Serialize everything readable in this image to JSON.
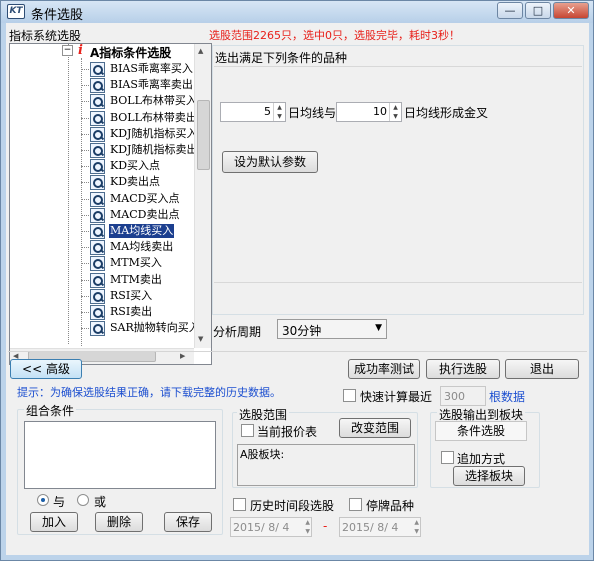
{
  "window": {
    "title": "条件选股",
    "icon_text": "KT",
    "controls": {
      "minimize": "—",
      "maximize": "□",
      "close": "✕"
    }
  },
  "left_panel": {
    "heading": "指标系统选股",
    "tree_root": {
      "expander": "−",
      "marker": "i",
      "label": "A指标条件选股"
    },
    "tree_items": [
      {
        "label": "BIAS乖离率买入",
        "selected": false
      },
      {
        "label": "BIAS乖离率卖出",
        "selected": false
      },
      {
        "label": "BOLL布林带买入",
        "selected": false
      },
      {
        "label": "BOLL布林带卖出",
        "selected": false
      },
      {
        "label": "KDJ随机指标买入",
        "selected": false
      },
      {
        "label": "KDJ随机指标卖出",
        "selected": false
      },
      {
        "label": "KD买入点",
        "selected": false
      },
      {
        "label": "KD卖出点",
        "selected": false
      },
      {
        "label": "MACD买入点",
        "selected": false
      },
      {
        "label": "MACD卖出点",
        "selected": false
      },
      {
        "label": "MA均线买入",
        "selected": true
      },
      {
        "label": "MA均线卖出",
        "selected": false
      },
      {
        "label": "MTM买入",
        "selected": false
      },
      {
        "label": "MTM卖出",
        "selected": false
      },
      {
        "label": "RSI买入",
        "selected": false
      },
      {
        "label": "RSI卖出",
        "selected": false
      },
      {
        "label": "SAR抛物转向买入",
        "selected": false
      }
    ]
  },
  "status_message": "选股范围2265只，选中0只，选股完毕，耗时3秒！",
  "condition": {
    "heading": "选出满足下列条件的品种",
    "param1": "5",
    "text1": "日均线与",
    "param2": "10",
    "text2": "日均线形成金叉",
    "default_button": "设为默认参数"
  },
  "period": {
    "label": "分析周期",
    "value": "30分钟"
  },
  "buttons": {
    "advanced": "<< 高级",
    "success_test": "成功率测试",
    "execute": "执行选股",
    "exit": "退出",
    "add": "加入",
    "delete": "删除",
    "save": "保存",
    "change_range": "改变范围",
    "select_board": "选择板块"
  },
  "hint": "提示：为确保选股结果正确，请下载完整的历史数据。",
  "quick_calc": {
    "label": "快速计算最近",
    "value": "300",
    "unit": "根数据"
  },
  "combo": {
    "title": "组合条件",
    "and_label": "与",
    "or_label": "或",
    "selected": "and"
  },
  "range": {
    "title": "选股范围",
    "current_price": "当前报价表",
    "board_text": "A股板块:"
  },
  "output": {
    "title": "选股输出到板块",
    "board_name": "条件选股",
    "append_mode": "追加方式"
  },
  "history": {
    "label": "历史时间段选股",
    "suspended": "停牌品种",
    "date_from": "2015/ 8/ 4",
    "dash": "-",
    "date_to": "2015/ 8/ 4"
  },
  "colors": {
    "accent_red": "#e8201a",
    "blue_link": "#1c4fd0",
    "selection": "#1c3f8f",
    "frame": "#bcd3ea"
  }
}
